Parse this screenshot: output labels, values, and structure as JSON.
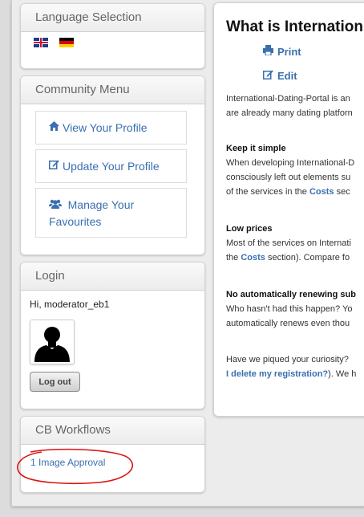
{
  "language": {
    "title": "Language Selection",
    "flags": [
      {
        "icon": "uk-flag-icon"
      },
      {
        "icon": "german-flag-icon"
      }
    ]
  },
  "community": {
    "title": "Community Menu",
    "items": [
      {
        "label": "View Your Profile",
        "icon": "home-icon"
      },
      {
        "label": "Update Your Profile",
        "icon": "edit-icon"
      },
      {
        "label": "Manage Your Favourites",
        "label_line1": "Manage Your",
        "label_line2": "Favourites",
        "icon": "users-icon"
      }
    ]
  },
  "login": {
    "title": "Login",
    "greeting": "Hi, moderator_eb1",
    "logout_label": "Log out"
  },
  "workflows": {
    "title": "CB Workflows",
    "link": "1 Image Approval"
  },
  "article": {
    "title": "What is Internation",
    "print_label": "Print",
    "edit_label": "Edit",
    "intro_line1": "International-Dating-Portal is an",
    "intro_line2": "are already many dating platforn",
    "h1": "Keep it simple",
    "p1_line1": "When developing International-D",
    "p1_line2": "consciously left out elements su",
    "p1_line3_pre": "of the services in the ",
    "p1_line3_link": "Costs",
    "p1_line3_post": " sec",
    "h2": "Low prices",
    "p2_line1": "Most of the services on Internati",
    "p2_line2_pre": "the ",
    "p2_line2_link": "Costs",
    "p2_line2_post": " section). Compare fo",
    "h3": "No automatically renewing sub",
    "p3_line1": "Who hasn't had this happen? Yo",
    "p3_line2": "automatically renews even thou",
    "p4_line1": "Have we piqued your curiosity?",
    "p4_line2_link": "I delete my registration?",
    "p4_line2_post": "). We h"
  },
  "annotation_color": "#dd1111"
}
